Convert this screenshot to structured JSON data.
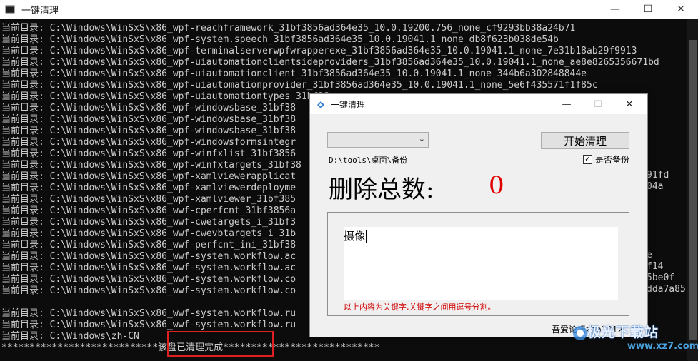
{
  "console": {
    "title": "一键清理",
    "minimize": "—",
    "maximize": "☐",
    "close": "✕",
    "lines": [
      "当前目录: C:\\Windows\\WinSxS\\x86_wpf-reachframework_31bf3856ad364e35_10.0.19200.756_none_cf9293bb38a24b71",
      "当前目录: C:\\Windows\\WinSxS\\x86_wpf-system.speech_31bf3856ad364e35_10.0.19041.1_none_db8f623b038de54b",
      "当前目录: C:\\Windows\\WinSxS\\x86_wpf-terminalserverwpfwrapperexe_31bf3856ad364e35_10.0.19041.1_none_7e31b18ab29f9913",
      "当前目录: C:\\Windows\\WinSxS\\x86_wpf-uiautomationclientsideproviders_31bf3856ad364e35_10.0.19041.1_none_ae8e8265356671bd",
      "当前目录: C:\\Windows\\WinSxS\\x86_wpf-uiautomationclient_31bf3856ad364e35_10.0.19041.1_none_344b6a302848844e",
      "当前目录: C:\\Windows\\WinSxS\\x86_wpf-uiautomationprovider_31bf3856ad364e35_10.0.19041.1_none_5e6f435571f1f85c",
      "当前目录: C:\\Windows\\WinSxS\\x86_wpf-uiautomationtypes_31bf38",
      "当前目录: C:\\Windows\\WinSxS\\x86_wpf-windowsbase_31bf38",
      "当前目录: C:\\Windows\\WinSxS\\x86_wpf-windowsbase_31bf38",
      "当前目录: C:\\Windows\\WinSxS\\x86_wpf-windowsbase_31bf38",
      "当前目录: C:\\Windows\\WinSxS\\x86_wpf-windowsformsintegr",
      "当前目录: C:\\Windows\\WinSxS\\x86_wpf-winfxlist_31bf3856",
      "当前目录: C:\\Windows\\WinSxS\\x86_wpf-winfxtargets_31bf38",
      "当前目录: C:\\Windows\\WinSxS\\x86_wpf-xamlviewerapplicat",
      "当前目录: C:\\Windows\\WinSxS\\x86_wpf-xamlviewerdeployme",
      "当前目录: C:\\Windows\\WinSxS\\x86_wpf-xamlviewer_31bf385",
      "当前目录: C:\\Windows\\WinSxS\\x86_wwf-cperfcnt_31bf3856a",
      "当前目录: C:\\Windows\\WinSxS\\x86_wwf-cwetargets_i_31bf3",
      "当前目录: C:\\Windows\\WinSxS\\x86_wwf-cwevbtargets_i_31b",
      "当前目录: C:\\Windows\\WinSxS\\x86_wwf-perfcnt_ini_31bf38",
      "当前目录: C:\\Windows\\WinSxS\\x86_wwf-system.workflow.ac",
      "当前目录: C:\\Windows\\WinSxS\\x86_wwf-system.workflow.ac",
      "当前目录: C:\\Windows\\WinSxS\\x86_wwf-system.workflow.co",
      "当前目录: C:\\Windows\\WinSxS\\x86_wwf-system.workflow.co",
      "",
      "当前目录: C:\\Windows\\WinSxS\\x86_wwf-system.workflow.ru",
      "当前目录: C:\\Windows\\WinSxS\\x86_wwf-system.workflow.ru",
      "当前目录: C:\\Windows\\zh-CN",
      "****************************该盘已清理完成****************************"
    ],
    "right_fragments": [
      "91fd",
      "04a",
      "e",
      "f14",
      "5be0f",
      "dda7a85"
    ]
  },
  "dialog": {
    "title": "一键清理",
    "minimize": "—",
    "maximize": "☐",
    "close": "✕",
    "combo_value": "",
    "start_button": "开始清理",
    "path": "D:\\tools\\桌面\\备份",
    "backup_label": "是否备份",
    "backup_checked": "✓",
    "total_label": "删除总数:",
    "total_value": "0",
    "keywords": "摄像",
    "hint": "以上内容为关键字,关键字之间用逗号分割。",
    "credit": "吾爱论坛zbb2012"
  },
  "watermark": {
    "text": "极光下载站",
    "url": "www.xz7.com"
  }
}
